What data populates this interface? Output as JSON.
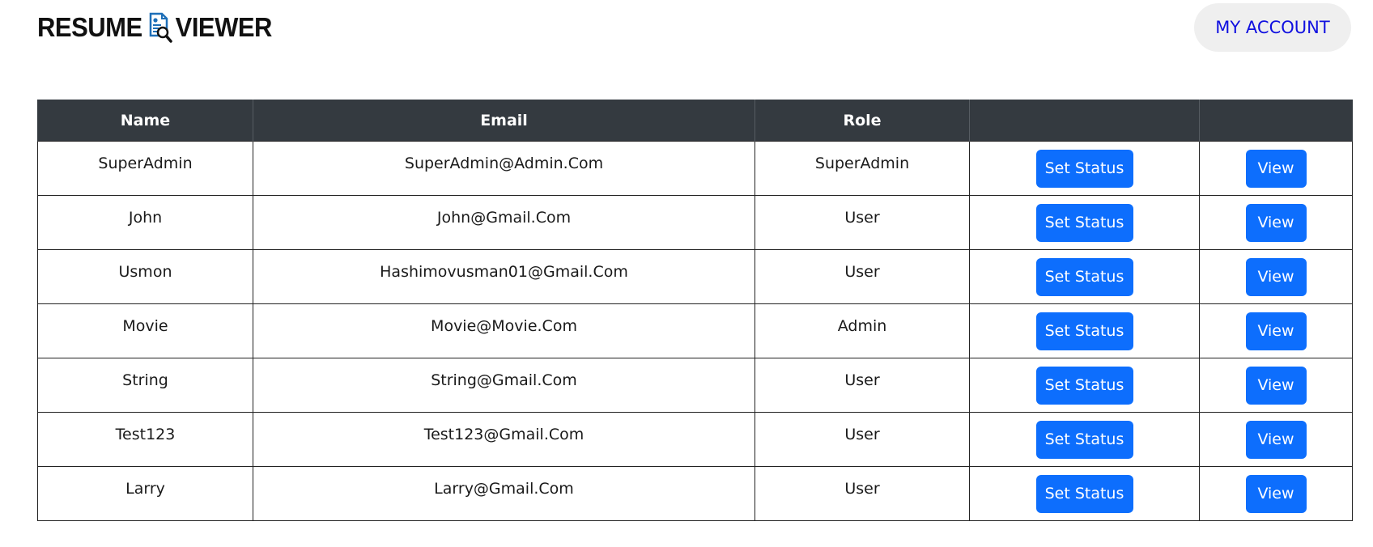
{
  "header": {
    "logo_left": "RESUME",
    "logo_right": "VIEWER",
    "account_label": "MY ACCOUNT"
  },
  "table": {
    "columns": [
      "Name",
      "Email",
      "Role",
      "",
      ""
    ],
    "rows": [
      {
        "name": "SuperAdmin",
        "email": "SuperAdmin@Admin.Com",
        "role": "SuperAdmin",
        "status_label": "Set Status",
        "view_label": "View"
      },
      {
        "name": "John",
        "email": "John@Gmail.Com",
        "role": "User",
        "status_label": "Set Status",
        "view_label": "View"
      },
      {
        "name": "Usmon",
        "email": "Hashimovusman01@Gmail.Com",
        "role": "User",
        "status_label": "Set Status",
        "view_label": "View"
      },
      {
        "name": "Movie",
        "email": "Movie@Movie.Com",
        "role": "Admin",
        "status_label": "Set Status",
        "view_label": "View"
      },
      {
        "name": "String",
        "email": "String@Gmail.Com",
        "role": "User",
        "status_label": "Set Status",
        "view_label": "View"
      },
      {
        "name": "Test123",
        "email": "Test123@Gmail.Com",
        "role": "User",
        "status_label": "Set Status",
        "view_label": "View"
      },
      {
        "name": "Larry",
        "email": "Larry@Gmail.Com",
        "role": "User",
        "status_label": "Set Status",
        "view_label": "View"
      }
    ]
  },
  "colors": {
    "header_bg": "#343a40",
    "button_primary": "#0d6efd",
    "account_text": "#1010e0",
    "account_bg": "#efefef"
  },
  "icons": {
    "logo": "resume-magnifier-icon"
  }
}
